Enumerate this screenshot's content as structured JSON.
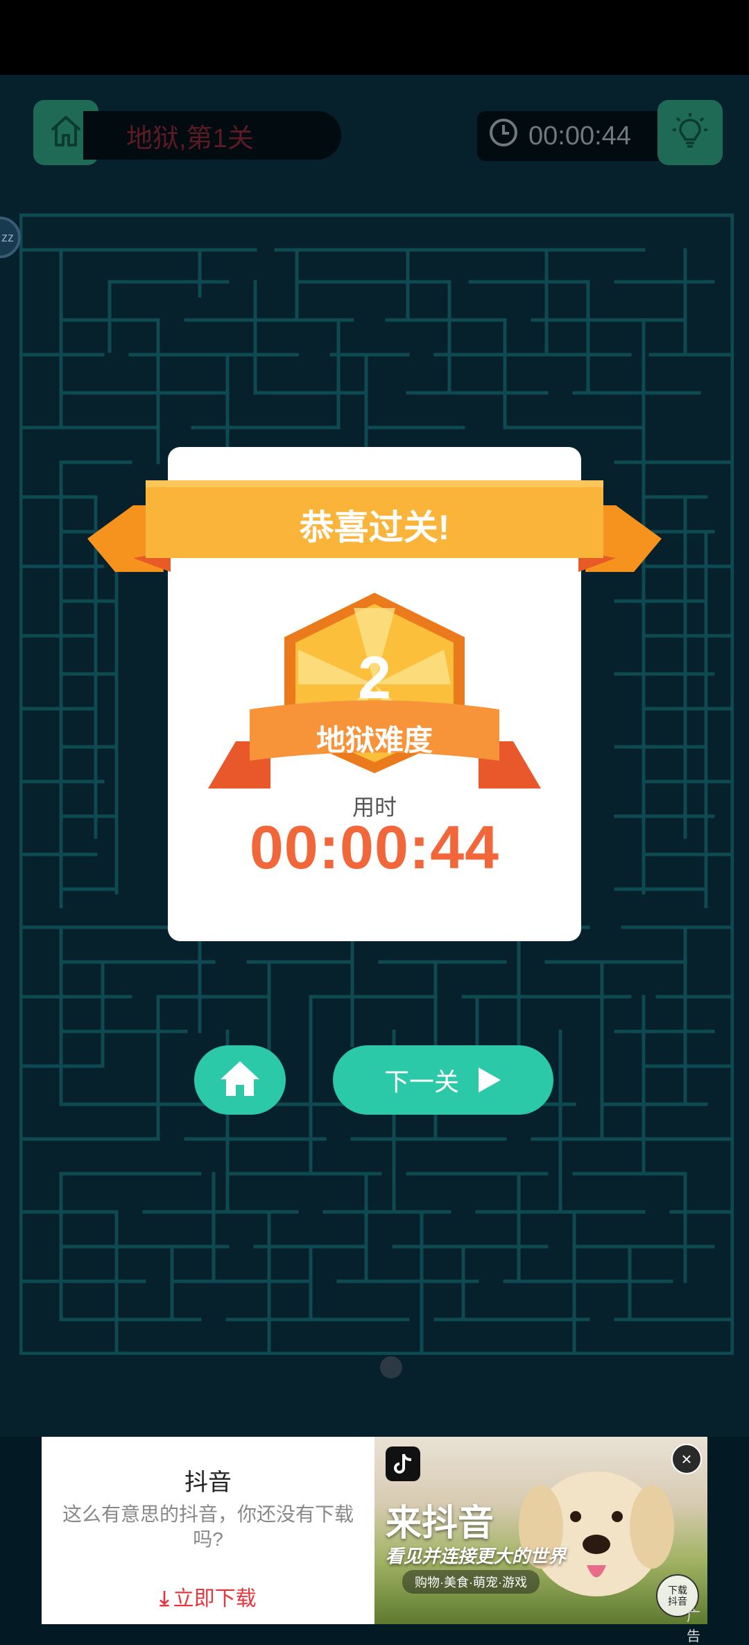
{
  "header": {
    "level_label": "地狱,第1关",
    "timer": "00:00:44"
  },
  "side_badge": "zz",
  "success": {
    "title": "恭喜过关!",
    "badge_number": "2",
    "difficulty_label": "地狱难度",
    "time_label": "用时",
    "time_value": "00:00:44"
  },
  "actions": {
    "next_label": "下一关"
  },
  "ad": {
    "title": "抖音",
    "description": "这么有意思的抖音，你还没有下载吗?",
    "download_label": "立即下载",
    "brand": "来抖音",
    "slogan": "看见并连接更大的世界",
    "tags": "购物·美食·萌宠·游戏",
    "download_badge": "下载\n抖音",
    "ad_mark": "广告"
  },
  "colors": {
    "accent_teal": "#2cc9a9",
    "timer_orange": "#f2673a",
    "ribbon_gold": "#fbb43a",
    "maze_line": "#0e4a51"
  },
  "icons": [
    "home-icon",
    "clock-icon",
    "lightbulb-icon",
    "play-icon",
    "download-icon",
    "close-icon"
  ]
}
